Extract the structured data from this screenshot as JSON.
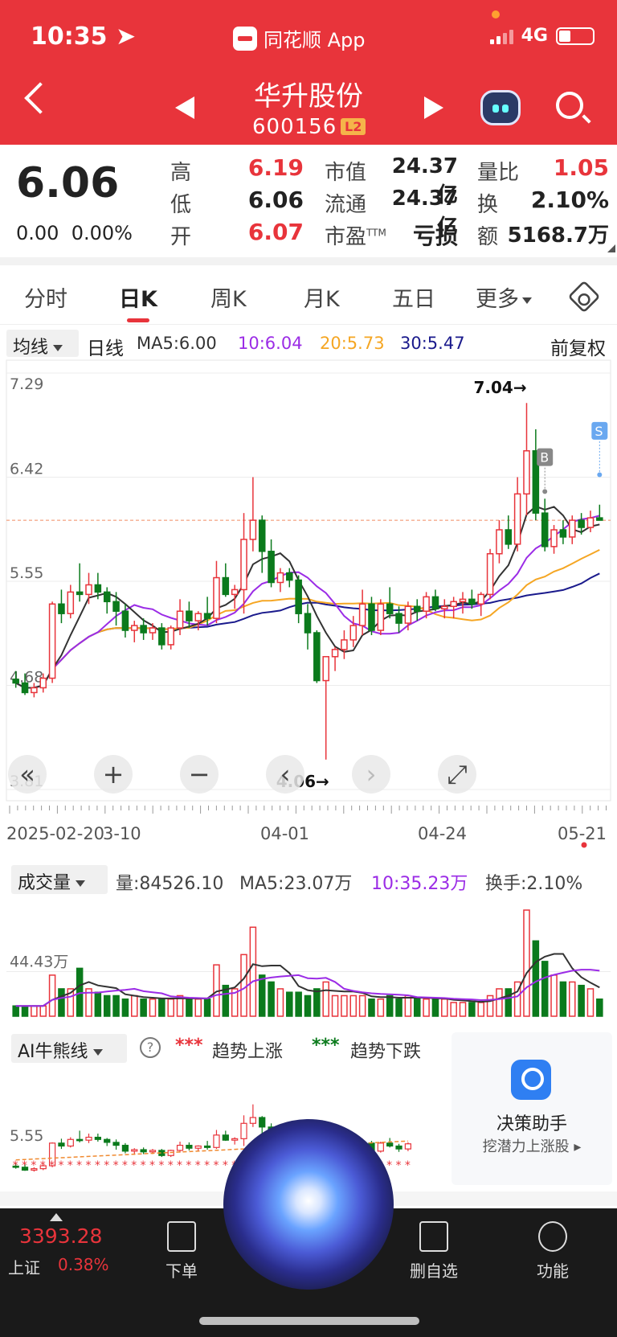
{
  "status": {
    "time": "10:35",
    "app": "同花顺 App",
    "network": "4G"
  },
  "header": {
    "name": "华升股份",
    "code": "600156",
    "badge": "L2"
  },
  "quote": {
    "price": "6.06",
    "change": "0.00",
    "change_pct": "0.00%",
    "high_label": "高",
    "high": "6.19",
    "low_label": "低",
    "low": "6.06",
    "open_label": "开",
    "open": "6.07",
    "mcap_label": "市值",
    "mcap": "24.37亿",
    "float_label": "流通",
    "float": "24.37亿",
    "pe_label": "市盈",
    "pe_sup": "TTM",
    "pe": "亏损",
    "vr_label": "量比",
    "vr": "1.05",
    "turn_label": "换",
    "turn": "2.10%",
    "amt_label": "额",
    "amt": "5168.7万"
  },
  "tabs": [
    "分时",
    "日K",
    "周K",
    "月K",
    "五日",
    "更多"
  ],
  "ma_bar": {
    "select": "均线",
    "period": "日线",
    "ma5": "MA5:6.00",
    "ma10": "10:6.04",
    "ma20": "20:5.73",
    "ma30": "30:5.47",
    "adjust": "前复权",
    "color_ma5": "#333333",
    "color_ma10": "#9b2ce6",
    "color_ma20": "#f5a623",
    "color_ma30": "#1a1a8c"
  },
  "chart_data": [
    {
      "type": "candlestick",
      "x_labels": [
        "2025-02-20",
        "3-10",
        "04-01",
        "04-24",
        "05-21"
      ],
      "y_ticks": [
        "7.29",
        "6.42",
        "5.55",
        "4.68",
        "3.81"
      ],
      "ylim": [
        3.81,
        7.29
      ],
      "annotations": [
        "7.04→",
        "4.06→",
        "B",
        "S"
      ],
      "ohlc": [
        [
          4.73,
          4.8,
          4.66,
          4.7
        ],
        [
          4.7,
          4.78,
          4.6,
          4.62
        ],
        [
          4.62,
          4.7,
          4.58,
          4.66
        ],
        [
          4.66,
          4.78,
          4.62,
          4.74
        ],
        [
          4.74,
          5.38,
          4.7,
          5.36
        ],
        [
          5.36,
          5.48,
          5.2,
          5.28
        ],
        [
          5.28,
          5.52,
          5.24,
          5.46
        ],
        [
          5.46,
          5.7,
          5.38,
          5.44
        ],
        [
          5.44,
          5.62,
          5.36,
          5.52
        ],
        [
          5.52,
          5.62,
          5.4,
          5.46
        ],
        [
          5.46,
          5.5,
          5.28,
          5.38
        ],
        [
          5.38,
          5.46,
          5.18,
          5.3
        ],
        [
          5.3,
          5.36,
          5.08,
          5.14
        ],
        [
          5.14,
          5.22,
          5.04,
          5.18
        ],
        [
          5.18,
          5.24,
          5.06,
          5.12
        ],
        [
          5.12,
          5.2,
          5.06,
          5.16
        ],
        [
          5.16,
          5.2,
          4.98,
          5.02
        ],
        [
          5.02,
          5.18,
          4.98,
          5.16
        ],
        [
          5.16,
          5.4,
          5.1,
          5.3
        ],
        [
          5.3,
          5.38,
          5.16,
          5.22
        ],
        [
          5.22,
          5.3,
          5.14,
          5.28
        ],
        [
          5.28,
          5.42,
          5.18,
          5.24
        ],
        [
          5.24,
          5.72,
          5.2,
          5.58
        ],
        [
          5.58,
          5.7,
          5.42,
          5.44
        ],
        [
          5.44,
          5.52,
          5.32,
          5.48
        ],
        [
          5.48,
          6.12,
          5.28,
          5.9
        ],
        [
          5.9,
          6.42,
          5.8,
          6.06
        ],
        [
          6.06,
          6.1,
          5.62,
          5.8
        ],
        [
          5.8,
          5.9,
          5.5,
          5.54
        ],
        [
          5.54,
          5.66,
          5.46,
          5.62
        ],
        [
          5.62,
          5.66,
          5.5,
          5.56
        ],
        [
          5.56,
          5.6,
          5.2,
          5.28
        ],
        [
          5.28,
          5.36,
          4.98,
          5.12
        ],
        [
          5.12,
          5.14,
          4.7,
          4.72
        ],
        [
          4.72,
          4.84,
          4.06,
          4.92
        ],
        [
          4.92,
          5.0,
          4.8,
          4.98
        ],
        [
          4.98,
          5.14,
          4.9,
          5.06
        ],
        [
          5.06,
          5.26,
          5.0,
          5.18
        ],
        [
          5.18,
          5.48,
          5.1,
          5.36
        ],
        [
          5.36,
          5.42,
          5.1,
          5.14
        ],
        [
          5.14,
          5.4,
          5.1,
          5.36
        ],
        [
          5.36,
          5.5,
          5.24,
          5.28
        ],
        [
          5.28,
          5.34,
          5.12,
          5.2
        ],
        [
          5.2,
          5.38,
          5.14,
          5.34
        ],
        [
          5.34,
          5.4,
          5.22,
          5.3
        ],
        [
          5.3,
          5.46,
          5.24,
          5.42
        ],
        [
          5.42,
          5.48,
          5.3,
          5.32
        ],
        [
          5.32,
          5.4,
          5.24,
          5.34
        ],
        [
          5.34,
          5.42,
          5.24,
          5.38
        ],
        [
          5.38,
          5.46,
          5.28,
          5.4
        ],
        [
          5.4,
          5.48,
          5.32,
          5.36
        ],
        [
          5.36,
          5.46,
          5.26,
          5.44
        ],
        [
          5.44,
          5.82,
          5.4,
          5.78
        ],
        [
          5.78,
          6.06,
          5.7,
          5.98
        ],
        [
          5.98,
          6.1,
          5.82,
          5.86
        ],
        [
          5.86,
          6.42,
          5.8,
          6.28
        ],
        [
          6.28,
          7.04,
          6.1,
          6.64
        ],
        [
          6.64,
          6.82,
          6.06,
          6.12
        ],
        [
          6.12,
          6.24,
          5.8,
          5.84
        ],
        [
          5.84,
          6.02,
          5.78,
          5.98
        ],
        [
          5.98,
          6.06,
          5.86,
          5.92
        ],
        [
          5.92,
          6.1,
          5.86,
          6.06
        ],
        [
          6.06,
          6.12,
          5.94,
          6.0
        ],
        [
          6.0,
          6.14,
          5.96,
          6.08
        ],
        [
          6.08,
          6.19,
          6.06,
          6.06
        ]
      ]
    },
    {
      "type": "bar",
      "title": "成交量",
      "y_ticks": [
        "44.43万"
      ],
      "values": [
        3,
        3,
        3,
        3,
        12,
        8,
        8,
        14,
        8,
        7,
        6,
        6,
        5,
        6,
        5,
        5,
        5,
        5,
        6,
        5,
        5,
        5,
        15,
        9,
        8,
        18,
        26,
        12,
        10,
        8,
        7,
        7,
        6,
        8,
        10,
        6,
        6,
        6,
        6,
        5,
        5,
        6,
        5,
        6,
        5,
        5,
        5,
        5,
        4,
        4,
        4,
        4,
        6,
        8,
        8,
        10,
        31,
        22,
        16,
        12,
        10,
        10,
        9,
        8,
        5
      ]
    },
    {
      "type": "candlestick",
      "title": "AI牛熊线",
      "y_ticks": [
        "5.55"
      ]
    }
  ],
  "vol_bar": {
    "select": "成交量",
    "vol": "量:84526.10",
    "ma5": "MA5:23.07万",
    "ma10": "10:35.23万",
    "turn": "换手:2.10%"
  },
  "ai_bar": {
    "select": "AI牛熊线",
    "help": "?",
    "up": "趋势上涨",
    "down": "趋势下跌",
    "dots": "***"
  },
  "assistant": {
    "title": "决策助手",
    "sub": "挖潜力上涨股"
  },
  "bottom_nav": {
    "index_value": "3393.28",
    "index_name": "上证",
    "index_pct": "0.38%",
    "order": "下单",
    "remove": "删自选",
    "func": "功能"
  },
  "colors": {
    "red": "#e8343b",
    "green": "#0b7a1c"
  }
}
